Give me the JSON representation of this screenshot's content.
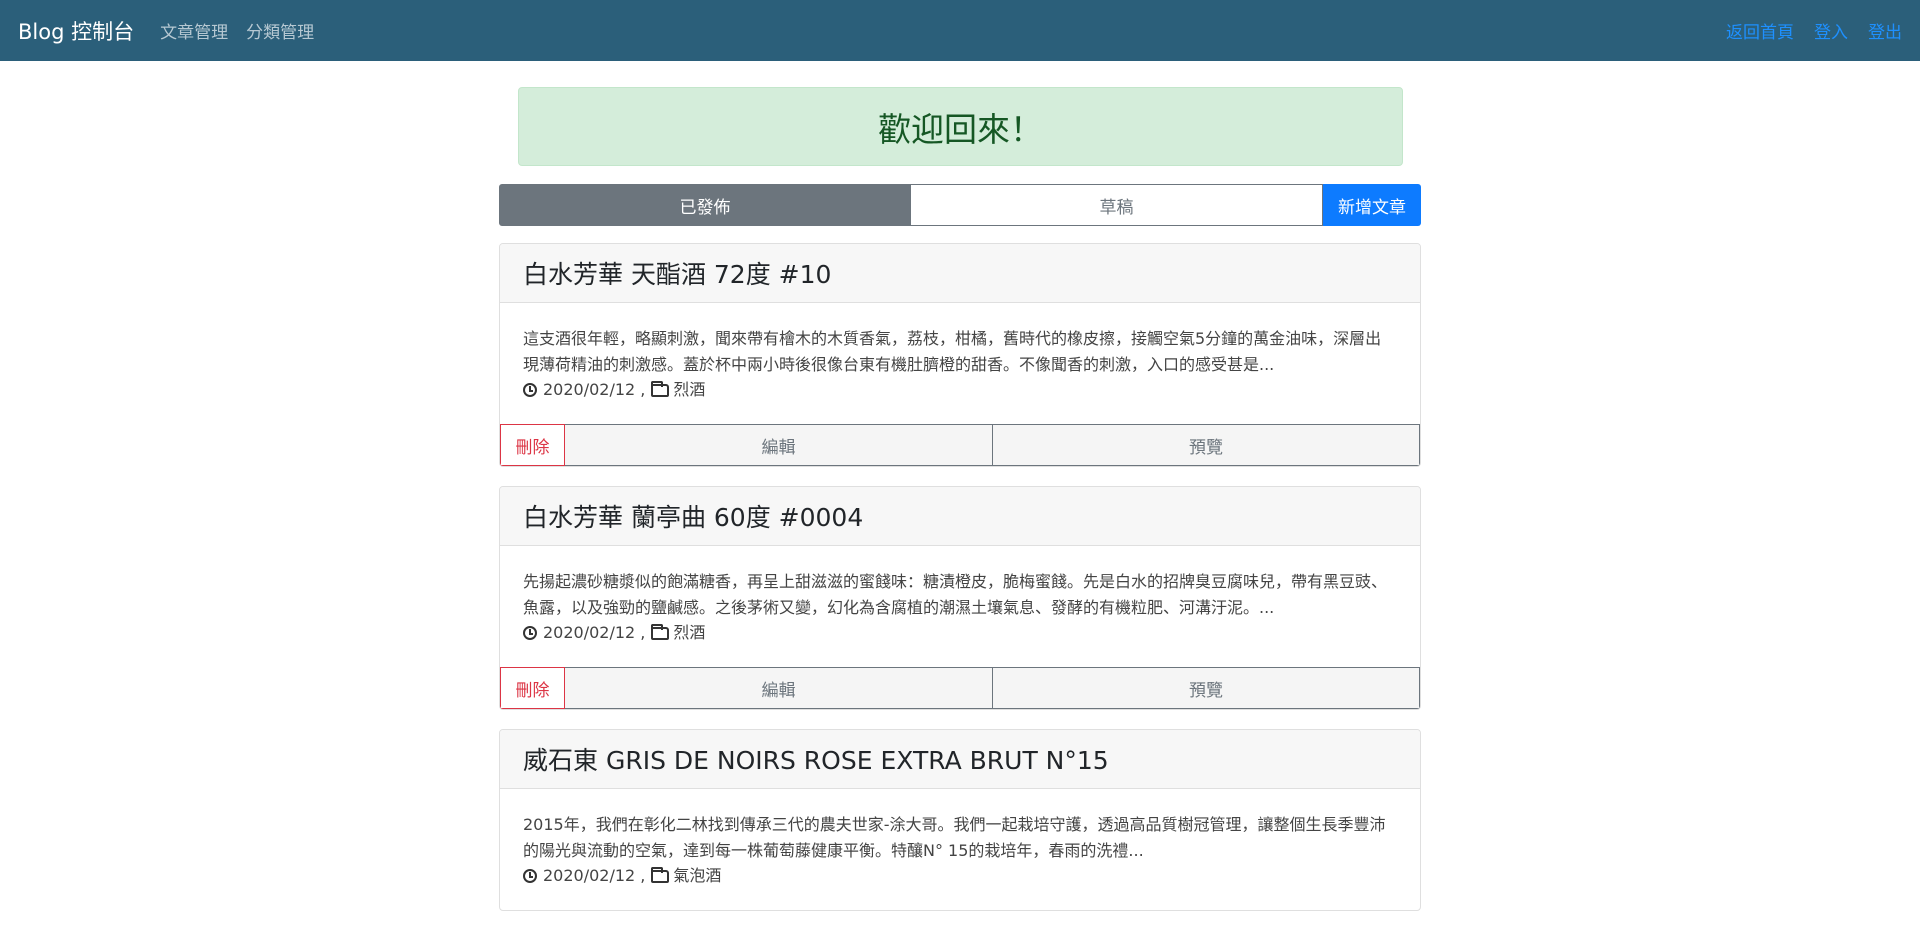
{
  "navbar": {
    "brand": "Blog 控制台",
    "links": [
      "文章管理",
      "分類管理"
    ],
    "right_links": [
      "返回首頁",
      "登入",
      "登出"
    ]
  },
  "welcome": "歡迎回來！",
  "tabs": {
    "published": "已發佈",
    "draft": "草稿",
    "new_post": "新增文章"
  },
  "posts": [
    {
      "title": "白水芳華 天酯酒 72度 #10",
      "excerpt": "這支酒很年輕，略顯刺激，聞來帶有檜木的木質香氣，荔枝，柑橘，舊時代的橡皮擦，接觸空氣5分鐘的萬金油味，深層出現薄荷精油的刺激感。蓋於杯中兩小時後很像台東有機肚臍橙的甜香。不像聞香的刺激，入口的感受甚是...",
      "date": "2020/02/12 ,",
      "category": "烈酒",
      "actions": {
        "delete": "刪除",
        "edit": "編輯",
        "preview": "預覽"
      }
    },
    {
      "title": "白水芳華 蘭亭曲 60度 #0004",
      "excerpt": "先揚起濃砂糖漿似的飽滿糖香，再呈上甜滋滋的蜜餞味：糖漬橙皮，脆梅蜜餞。先是白水的招牌臭豆腐味兒，帶有黑豆豉、魚露，以及強勁的鹽鹹感。之後茅術又變，幻化為含腐植的潮濕土壤氣息、發酵的有機粒肥、河溝汙泥。...",
      "date": "2020/02/12 ,",
      "category": "烈酒",
      "actions": {
        "delete": "刪除",
        "edit": "編輯",
        "preview": "預覽"
      }
    },
    {
      "title": "威石東 GRIS DE NOIRS ROSE EXTRA BRUT N°15",
      "excerpt": "2015年，我們在彰化二林找到傳承三代的農夫世家-涂大哥。我們一起栽培守護，透過高品質樹冠管理，讓整個生長季豐沛的陽光與流動的空氣，達到每一株葡萄藤健康平衡。特釀N° 15的栽培年，春雨的洗禮...",
      "date": "2020/02/12 ,",
      "category": "氣泡酒"
    }
  ]
}
